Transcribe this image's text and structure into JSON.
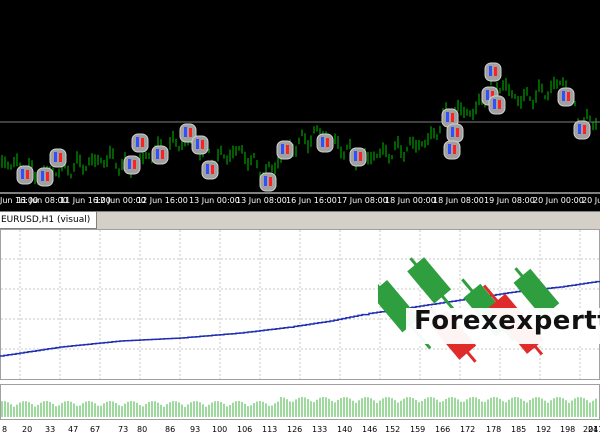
{
  "chart_window": {
    "symbol_tab": "EURUSD,H1 (visual)",
    "time_axis": [
      "11 Jun 00:00",
      "11 Jun 08:00",
      "11 Jun 16:00",
      "12 Jun 00:00",
      "12 Jun 08:00",
      "12 Jun 16:00",
      "13 Jun 00:00",
      "13 Jun 08:00",
      "15 Jun 16:00",
      "16 Jun 16:00",
      "17 Jun 00:00",
      "17 Jun 08:00",
      "18 Jun 00:00",
      "18 Jun 08:00",
      "18 Jun 16:00",
      "19 Jun 00:00",
      "19 Jun 08:00",
      "20 Jun 00:00",
      "20 Jun 08:00"
    ],
    "time_axis_partial_left": "Jun 16:00",
    "colors": {
      "background": "#000000",
      "candles": "#00c000",
      "level_line": "#808080",
      "trade_marker": "#a0a0a0"
    }
  },
  "report": {
    "x_axis": [
      "8",
      "20",
      "33",
      "47",
      "67",
      "73",
      "80",
      "86",
      "93",
      "100",
      "106",
      "113",
      "126",
      "133",
      "140",
      "146",
      "152",
      "159",
      "166",
      "172",
      "178",
      "185",
      "192",
      "198",
      "204",
      "211"
    ],
    "colors": {
      "balance_line": "#1f2fb0",
      "volume_bars": "#3cb43c",
      "grid": "#c8c8c8"
    }
  },
  "watermark": {
    "text": "Forexexpertt",
    "colors": {
      "green": "#2e9e3e",
      "red": "#e02b2b"
    }
  }
}
